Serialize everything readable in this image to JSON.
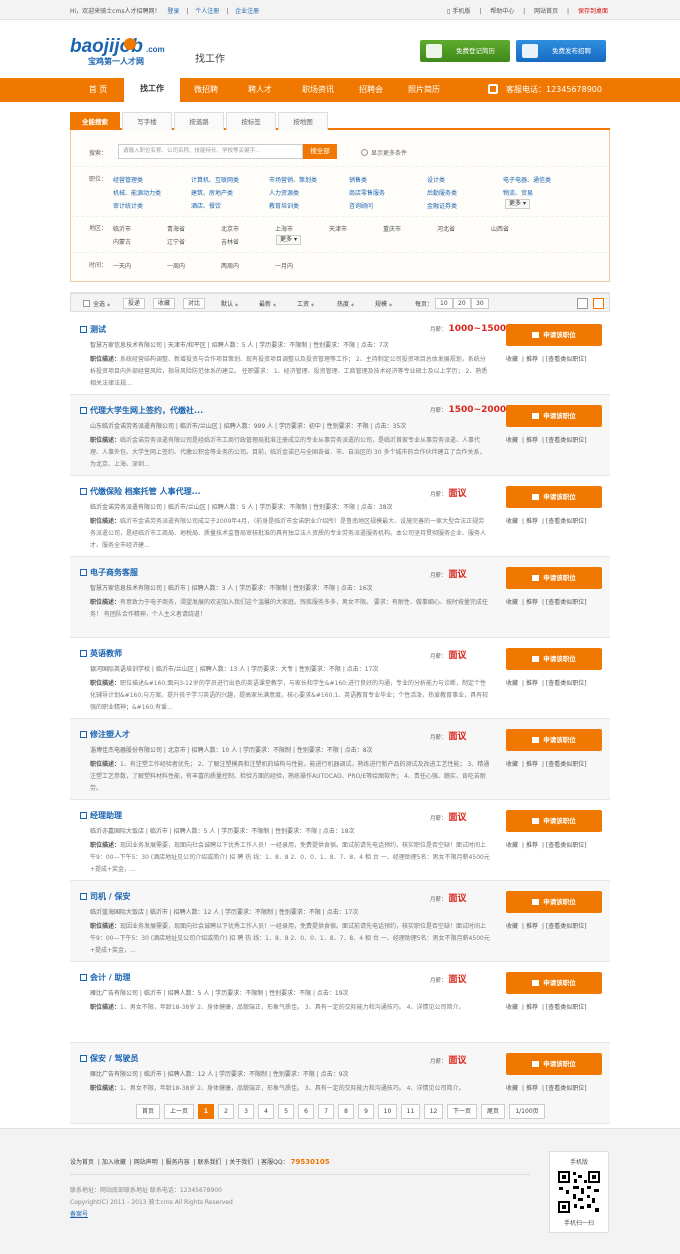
{
  "topbar": {
    "welcome": "Hi，欢迎来骑士cms人才招聘网！",
    "login": "登录",
    "personal_reg": "个人注册",
    "company_reg": "企业注册",
    "mobile": "手机版",
    "help": "帮助中心",
    "home": "网站首页",
    "save_desktop": "保存到桌面"
  },
  "header": {
    "logo_text": "baojijob",
    "logo_domain": ".com",
    "logo_slogan": "宝鸡第一人才网",
    "page_title": "找工作",
    "reg_resume": "免费登记简历",
    "post_job": "免费发布招聘"
  },
  "nav": {
    "items": [
      "首 页",
      "找工作",
      "微招聘",
      "聘人才",
      "职场资讯",
      "招聘会",
      "照片简历"
    ],
    "active": "找工作",
    "phone": "客服电话：12345678900"
  },
  "search_tabs": [
    "全能搜索",
    "写字楼",
    "按道路",
    "按标签",
    "按地图"
  ],
  "filter": {
    "search_label": "搜索：",
    "search_placeholder": "请输入职位名称、公司名称、技能特长、学校等关键字...",
    "search_button": "搜全部",
    "show_more": "显示更多条件",
    "job_label": "职位：",
    "jobs": [
      "经营管理类",
      "计算机、互联网类",
      "市场营销、策划类",
      "销售类",
      "设计类",
      "电子电器、通信类",
      "机械、能源动力类",
      "建筑、房地产类",
      "人力资源类",
      "商店零售服务",
      "后勤服务类",
      "物流、贸易",
      "审计统计类",
      "酒店、餐饮",
      "教育培训类",
      "咨询顾问",
      "金融证券类"
    ],
    "more": "更多",
    "area_label": "地区：",
    "areas": [
      "临沂市",
      "青海省",
      "北京市",
      "上海市",
      "天津市",
      "重庆市",
      "河北省",
      "山西省",
      "内蒙古",
      "辽宁省",
      "吉林省"
    ],
    "time_label": "时间：",
    "times": [
      "一天内",
      "一周内",
      "两周内",
      "一月内"
    ]
  },
  "toolbar": {
    "select_all": "全选",
    "apply": "投递",
    "collect": "收藏",
    "compare": "对比",
    "sorts": [
      "默认",
      "最新",
      "工资",
      "热度",
      "规模"
    ],
    "per_page": "每页：",
    "page_sizes": [
      "10",
      "20",
      "30"
    ]
  },
  "job_common": {
    "desc_label": "职位描述：",
    "salary_label": "月薪：",
    "apply": "申请该职位",
    "collect": "收藏",
    "recommend": "推荐",
    "similar": "[查看类似职位]"
  },
  "jobs": [
    {
      "title": "测试",
      "salary": "1000~1500",
      "meta": "智慧万家信息技术有限公司 | 天津市/和平区 | 招聘人数：5 人 | 学历要求：不限制 | 性别要求：不限 | 点击：7次",
      "desc": "系统经营结构调整、新增投资与合作项目策划、现有投资项目调整以及投资管理等工作； 2、主持制定公司投资项目总体发展规划，系统分析投资项目内外部经营风险，指导风险防范体系的建立。 任职要求： 1、经济管理、投资管理、工商管理及技术经济等专业硕士及以上学历； 2、熟悉相关法律法规..."
    },
    {
      "title": "代理大学生网上签约，代缴社...",
      "salary": "1500~2000",
      "meta": "山东临沂金诺劳务派遣有限公司 | 临沂市/兰山区 | 招聘人数：999 人 | 学历要求：初中 | 性别要求：不限 | 点击：35次",
      "desc": "临沂金诺劳务派遣有限公司是经临沂市工商行政管理局批准注册成立的专业从事劳务派遣的公司，是临沂首家专业从事劳务派遣、人事代理、人事外包、大学生网上签约、代缴公积金等业务的公司。目前，临沂金诺已与全国各省、市、自治区的 30 多个城市的合作伙伴建立了合作关系，为北京、上海、深圳..."
    },
    {
      "title": "代缴保险 档案托管 人事代理...",
      "salary": "面议",
      "meta": "临沂金诺劳务派遣有限公司 | 临沂市/兰山区 | 招聘人数：5 人 | 学历要求：不限制 | 性别要求：不限 | 点击：38次",
      "desc": "临沂市金诺劳务派遣有限公司成立于2009年4月，（前身是临沂市金诺职业介绍所）是鲁南地区规模最大、设施完善的一家大型合法正规劳务派遣公司，是经临沂市工商局、地税局、质量技术监督局审核批准的具有独立法人资质的专业劳务派遣服务机构。本公司坚持贯彻服务企业、服务人才、服务全市经济建..."
    },
    {
      "title": "电子商务客服",
      "salary": "面议",
      "meta": "智慧万家信息技术有限公司 | 临沂市 | 招聘人数：3 人 | 学历要求：不限制 | 性别要求：不限 | 点击：16次",
      "desc": "有意致力于电子商务，渴望发展的欢迎加入我们这个温馨的大家庭。残疾服务多多，男女不限。 要求：有耐性、做事细心、按时按量完成任务！ 有团队合作精神，个人主义者请绕道！"
    },
    {
      "title": "英语教师",
      "salary": "面议",
      "meta": "银河国际英语培训学校 | 临沂市/兰山区 | 招聘人数：13 人 | 学历要求：大专 | 性别要求：不限 | 点击：17次",
      "desc": "职位描述&#160;面向3-12岁的学员进行出色的英语课堂教学，与家长和学生&#160;进行良好的沟通，专业的分析能力与诊断，制定个性化辅导计划&#160;与方案。提升孩子学习英语的兴趣，提高家长满意度。核心要求&#160;1、英语教育专业毕业；个性活泼，热爱教育事业，具有较强的职业精神；&#160;有爱..."
    },
    {
      "title": "修注塑人才",
      "salary": "面议",
      "meta": "淄博佳杰电器股份有限公司 | 北京市 | 招聘人数：10 人 | 学历要求：不限制 | 性别要求：不限 | 点击：8次",
      "desc": "1、有注塑工作经验者优先； 2、了解注塑模具和注塑机的结构与性能，能进行机器调试，熟练进行新产品的测试及改进工艺性能； 3、精通注塑工艺参数，了解塑料材料性能，有丰富的质量控制、检验方面的经验，熟练操作AUTOCAD、PRO/E等绘图软件； 4、责任心强、踏实、肯吃苦耐劳。"
    },
    {
      "title": "经理助理",
      "salary": "面议",
      "meta": "临沂亦嘉国际大饭店 | 临沂市 | 招聘人数：5 人 | 学历要求：不限制 | 性别要求：不限 | 点击：18次",
      "desc": "现因业务发展需要，现面向社会诚聘以下优秀工作人员！一经录用，免费提供食宿。面试前请先电话预约，核实职位是否空缺！面试时间上午9：00—下午5：30 (酒店地址见公司介绍或简介) 招 聘 热 线：1．8．8 2．0．0．1．8．7．8．4 相 台 一、经理助理5名：男女不限月薪4500元+提成+奖金，..."
    },
    {
      "title": "司机 / 保安",
      "salary": "面议",
      "meta": "临沂蓝海国际大饭店 | 临沂市 | 招聘人数：12 人 | 学历要求：不限制 | 性别要求：不限 | 点击：17次",
      "desc": "现因业务发展需要，现面向社会诚聘以下优秀工作人员！一经录用，免费提供食宿。面试前请先电话预约，核实职位是否空缺！面试时间上午9：00—下午5：30 (酒店地址见公司介绍或简介) 招 聘 热 线：1．8．8 2．0．0．1．8．7．8．4 相 台 一、经理助理5名：男女不限月薪4500元+提成+奖金，..."
    },
    {
      "title": "会计 / 助理",
      "salary": "面议",
      "meta": "雁比广告有限公司 | 临沂市 | 招聘人数：5 人 | 学历要求：不限制 | 性别要求：不限 | 点击：19次",
      "desc": "1、男女不限，年龄18-38岁 2、身体健康，品貌端正，形象气质佳。 3、具有一定的交际能力和沟通技巧。 4、详情见公司简介。"
    },
    {
      "title": "保安 / 驾驶员",
      "salary": "面议",
      "meta": "雁比广告有限公司 | 临沂市 | 招聘人数：12 人 | 学历要求：不限制 | 性别要求：不限 | 点击：9次",
      "desc": "1、男女不限，年龄18-38岁 2、身体健康，品貌端正，形象气质佳。 3、具有一定的交际能力和沟通技巧。 4、详情见公司简介。"
    }
  ],
  "pager": {
    "first": "首页",
    "prev": "上一页",
    "pages": [
      "1",
      "2",
      "3",
      "4",
      "5",
      "6",
      "7",
      "8",
      "9",
      "10",
      "11",
      "12"
    ],
    "current": "1",
    "next": "下一页",
    "last": "尾页",
    "total": "1/100页"
  },
  "footer": {
    "links": [
      "设为首页",
      "加入收藏",
      "网站声明",
      "服务内容",
      "联系我们",
      "关于我们"
    ],
    "qq_label": "客服QQ：",
    "qq": "79530105",
    "contact": "联系地址：网站底部联系地址 联系电话：12345678900",
    "copyright": "Copyright(C) 2011 - 2013 骑士cms All Rights Reserved",
    "icp": "备案号",
    "qr_title": "手机版",
    "qr_caption": "手机扫一扫"
  },
  "colors": {
    "accent": "#f07800",
    "link": "#1b64b1",
    "salary": "#d9261c",
    "green_button": "#4a9a22",
    "blue_button": "#1f7bd0"
  }
}
